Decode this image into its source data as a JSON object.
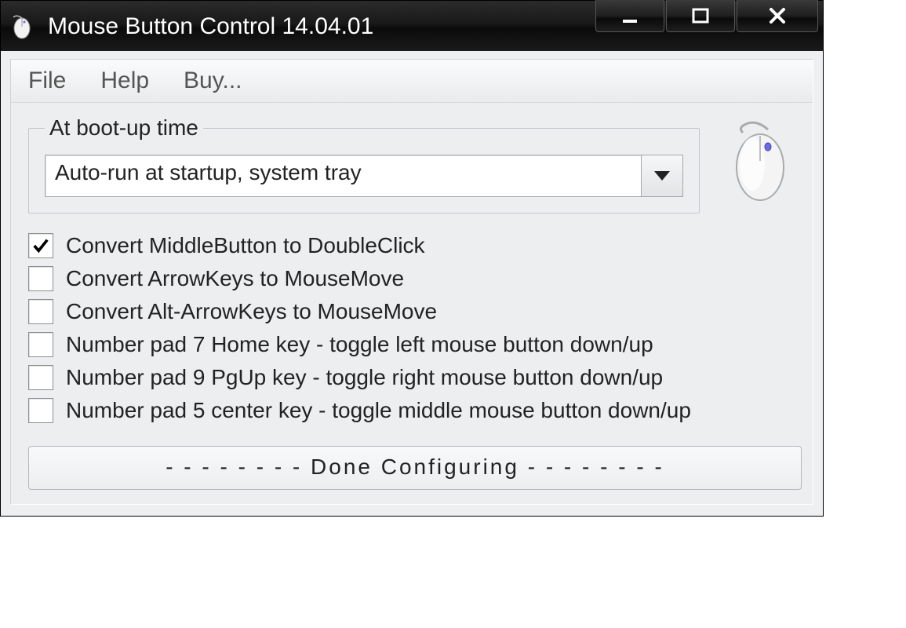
{
  "window": {
    "title": "Mouse Button Control 14.04.01"
  },
  "menubar": {
    "file": "File",
    "help": "Help",
    "buy": "Buy..."
  },
  "bootup": {
    "legend": "At boot-up time",
    "selected": "Auto-run at startup, system tray"
  },
  "options": [
    {
      "label": "Convert MiddleButton to DoubleClick",
      "checked": true
    },
    {
      "label": "Convert ArrowKeys to MouseMove",
      "checked": false
    },
    {
      "label": "Convert Alt-ArrowKeys to MouseMove",
      "checked": false
    },
    {
      "label": "Number pad 7 Home key - toggle left mouse button down/up",
      "checked": false
    },
    {
      "label": "Number pad 9 PgUp key - toggle right mouse button down/up",
      "checked": false
    },
    {
      "label": "Number pad 5 center key - toggle middle mouse button down/up",
      "checked": false
    }
  ],
  "done_label": "- - - - - - - -   Done Configuring   - - - - - - - -"
}
